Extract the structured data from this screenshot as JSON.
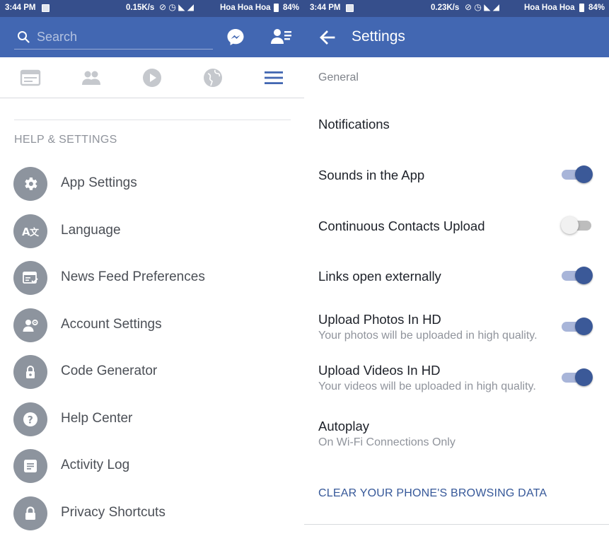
{
  "colors": {
    "brand_blue": "#4267b2",
    "status_bar": "#364f8c",
    "icon_gray": "#8d949e",
    "toggle_on": "#3b5998",
    "link_blue": "#365899"
  },
  "left_panel": {
    "status_bar": {
      "time": "3:44 PM",
      "net_speed": "0.15K/s",
      "carrier": "Hoa Hoa Hoa",
      "battery": "84%"
    },
    "search": {
      "placeholder": "Search"
    },
    "tabs": [
      {
        "icon": "news-feed-icon"
      },
      {
        "icon": "friends-icon"
      },
      {
        "icon": "video-icon"
      },
      {
        "icon": "globe-icon"
      },
      {
        "icon": "menu-icon",
        "active": true
      }
    ],
    "section_header": "HELP & SETTINGS",
    "menu_items": [
      {
        "label": "App Settings",
        "icon": "gear-icon"
      },
      {
        "label": "Language",
        "icon": "language-icon"
      },
      {
        "label": "News Feed Preferences",
        "icon": "news-feed-prefs-icon"
      },
      {
        "label": "Account Settings",
        "icon": "account-settings-icon"
      },
      {
        "label": "Code Generator",
        "icon": "code-generator-icon"
      },
      {
        "label": "Help Center",
        "icon": "help-icon"
      },
      {
        "label": "Activity Log",
        "icon": "activity-log-icon"
      },
      {
        "label": "Privacy Shortcuts",
        "icon": "lock-icon"
      }
    ]
  },
  "right_panel": {
    "status_bar": {
      "time": "3:44 PM",
      "net_speed": "0.23K/s",
      "carrier": "Hoa Hoa Hoa",
      "battery": "84%"
    },
    "title": "Settings",
    "section_label": "General",
    "settings": [
      {
        "title": "Notifications"
      },
      {
        "title": "Sounds in the App",
        "enabled": true
      },
      {
        "title": "Continuous Contacts Upload",
        "enabled": false
      },
      {
        "title": "Links open externally",
        "enabled": true
      },
      {
        "title": "Upload Photos In HD",
        "subtitle": "Your photos will be uploaded in high quality.",
        "enabled": true
      },
      {
        "title": "Upload Videos In HD",
        "subtitle": "Your videos will be uploaded in high quality.",
        "enabled": true
      },
      {
        "title": "Autoplay",
        "subtitle": "On Wi-Fi Connections Only"
      }
    ],
    "clear_data_label": "CLEAR YOUR PHONE'S BROWSING DATA"
  }
}
